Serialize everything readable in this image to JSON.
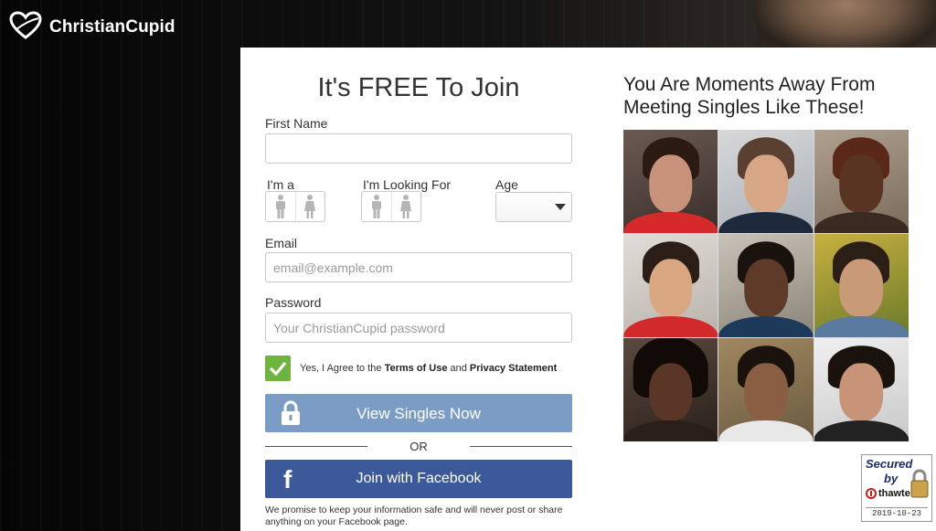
{
  "brand": {
    "name": "ChristianCupid"
  },
  "form": {
    "title": "It's FREE To Join",
    "first_name_label": "First Name",
    "first_name_value": "",
    "im_a_label": "I'm a",
    "looking_for_label": "I'm Looking For",
    "age_label": "Age",
    "age_value": "",
    "email_label": "Email",
    "email_placeholder": "email@example.com",
    "password_label": "Password",
    "password_placeholder": "Your ChristianCupid password",
    "agree_prefix": "Yes, I Agree to the ",
    "terms_link": "Terms of Use",
    "agree_and": " and ",
    "privacy_link": "Privacy Statement",
    "agree_checked": true,
    "submit_label": "View Singles Now",
    "or_text": "OR",
    "facebook_label": "Join with Facebook",
    "facebook_icon": "f",
    "promise": "We promise to keep your information safe and will never post or share anything on your Facebook page."
  },
  "gallery": {
    "heading": "You Are Moments Away From Meeting Singles Like These!"
  },
  "security_badge": {
    "line1": "Secured",
    "line2": "by",
    "brand": "thawte",
    "date": "2019-10-23"
  },
  "colors": {
    "accent_green": "#6fb43f",
    "view_button": "#7b9dc5",
    "facebook_blue": "#3b5998"
  }
}
